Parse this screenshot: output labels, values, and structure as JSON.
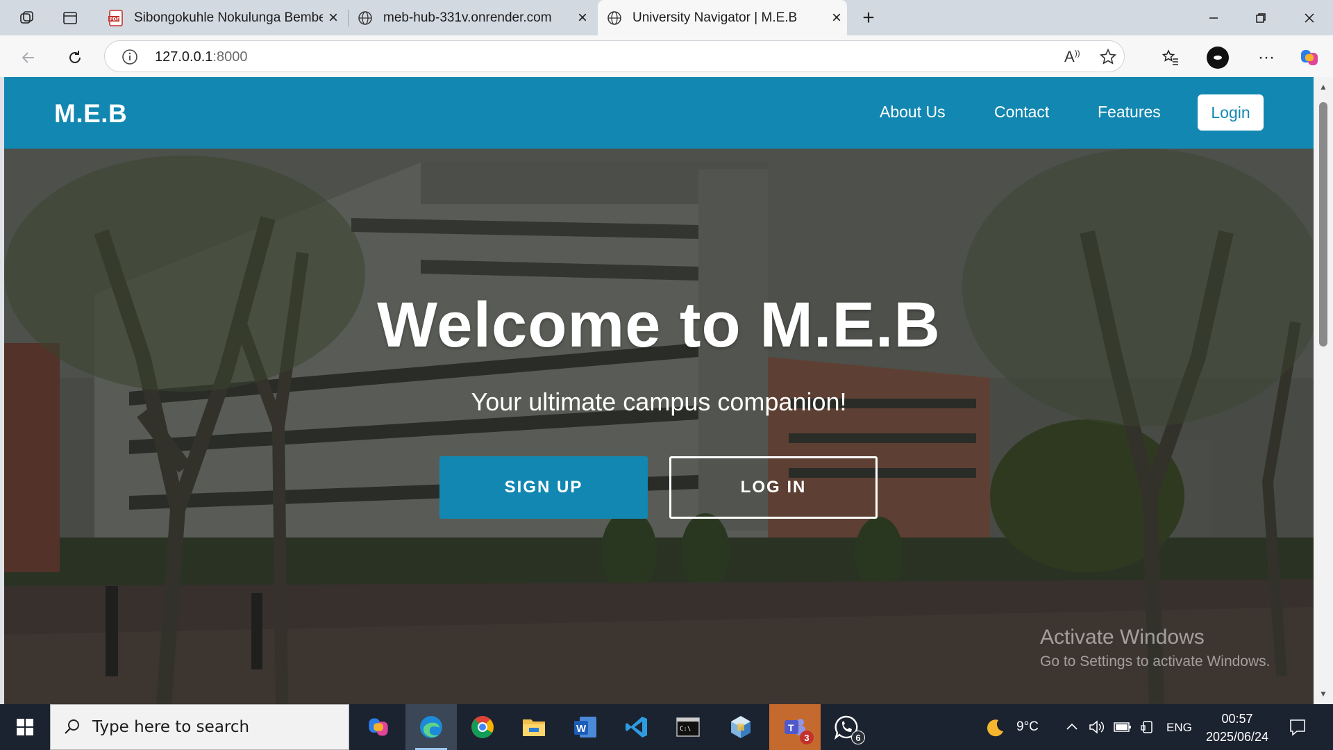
{
  "browser": {
    "tabs": [
      {
        "title": "Sibongokuhle Nokulunga Bembe",
        "icon": "pdf-icon"
      },
      {
        "title": "meb-hub-331v.onrender.com",
        "icon": "globe-icon"
      },
      {
        "title": "University Navigator | M.E.B",
        "icon": "globe-icon",
        "active": true
      }
    ],
    "url_host": "127.0.0.1",
    "url_port": ":8000"
  },
  "site": {
    "brand": "M.E.B",
    "nav": {
      "about": "About Us",
      "contact": "Contact",
      "features": "Features",
      "login": "Login"
    },
    "hero": {
      "title": "Welcome to M.E.B",
      "subtitle": "Your ultimate campus companion!",
      "signup": "SIGN UP",
      "login": "LOG IN"
    },
    "colors": {
      "primary": "#1287b1"
    }
  },
  "watermark": {
    "line1": "Activate Windows",
    "line2": "Go to Settings to activate Windows."
  },
  "taskbar": {
    "search_placeholder": "Type here to search",
    "weather": "9°C",
    "language": "ENG",
    "time": "00:57",
    "date": "2025/06/24",
    "teams_badge": "3",
    "whatsapp_badge": "6"
  }
}
